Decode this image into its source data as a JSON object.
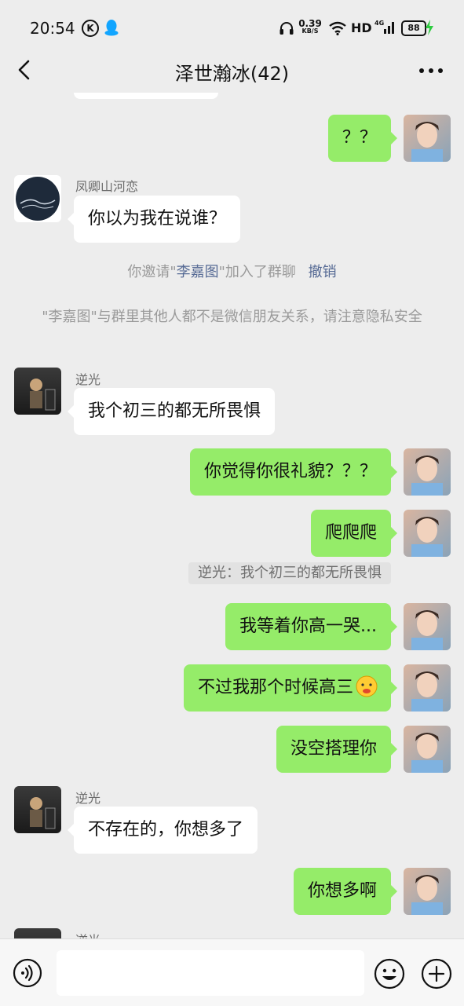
{
  "status_bar": {
    "time": "20:54",
    "k_badge": "K",
    "net_speed": "0.39",
    "net_unit": "KB/S",
    "hd": "HD",
    "signal": "4G",
    "battery": "88"
  },
  "header": {
    "title": "泽世瀚冰(42)"
  },
  "messages": {
    "m1": {
      "text": "？？"
    },
    "m2": {
      "sender": "凤卿山河恋",
      "text": "你以为我在说谁？"
    },
    "sys1": {
      "pre": "你邀请\"",
      "name": "李嘉图",
      "post": "\"加入了群聊",
      "action": "撤销"
    },
    "sys2": {
      "text": "\"李嘉图\"与群里其他人都不是微信朋友关系，请注意隐私安全"
    },
    "m3": {
      "sender": "逆光",
      "text": "我个初三的都无所畏惧"
    },
    "m4": {
      "text": "你觉得你很礼貌？？？"
    },
    "m5": {
      "text": "爬爬爬"
    },
    "quote1": {
      "text": "逆光：我个初三的都无所畏惧"
    },
    "m6": {
      "text": "我等着你高一哭..."
    },
    "m7": {
      "text": "不过我那个时候高三"
    },
    "m8": {
      "text": "没空搭理你"
    },
    "m9": {
      "sender": "逆光",
      "text": "不存在的，你想多了"
    },
    "m10": {
      "text": "你想多啊"
    },
    "m11": {
      "sender": "逆光"
    }
  },
  "colors": {
    "background": "#ededed",
    "outgoing_bubble": "#95ec69",
    "incoming_bubble": "#ffffff",
    "link": "#576b95"
  },
  "icons": [
    "back-arrow-icon",
    "more-icon",
    "voice-icon",
    "emoji-icon",
    "plus-icon"
  ]
}
